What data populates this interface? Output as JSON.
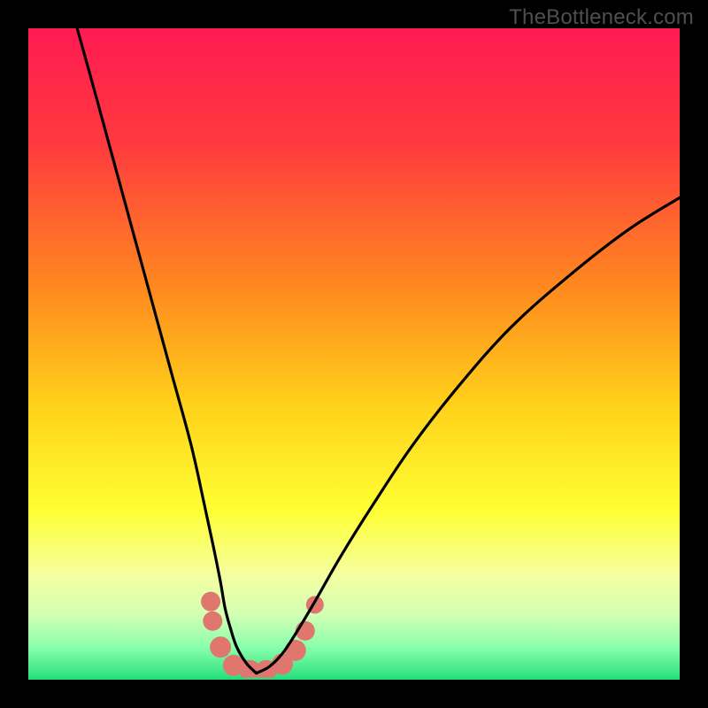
{
  "watermark": "TheBottleneck.com",
  "chart_data": {
    "type": "line",
    "title": "",
    "xlabel": "",
    "ylabel": "",
    "xlim": [
      0,
      100
    ],
    "ylim": [
      0,
      100
    ],
    "grid": false,
    "legend": false,
    "gradient_stops": [
      {
        "offset": 0.0,
        "color": "#ff1a52"
      },
      {
        "offset": 0.18,
        "color": "#ff3b3e"
      },
      {
        "offset": 0.4,
        "color": "#ff8a1f"
      },
      {
        "offset": 0.58,
        "color": "#ffd21a"
      },
      {
        "offset": 0.74,
        "color": "#ffff33"
      },
      {
        "offset": 0.84,
        "color": "#f4ffa0"
      },
      {
        "offset": 0.9,
        "color": "#d3ffb3"
      },
      {
        "offset": 0.95,
        "color": "#8affad"
      },
      {
        "offset": 1.0,
        "color": "#24e07c"
      }
    ],
    "series": [
      {
        "name": "curve-left",
        "stroke": "#000000",
        "x": [
          7.5,
          10,
          13,
          16,
          19,
          22,
          25,
          27,
          28.5,
          29.5,
          30.2,
          31,
          32,
          33.5,
          35
        ],
        "y": [
          100,
          91,
          80,
          69,
          58,
          47,
          36,
          27,
          20,
          15,
          11,
          8,
          5,
          2.5,
          1
        ]
      },
      {
        "name": "curve-right",
        "stroke": "#000000",
        "x": [
          35,
          37,
          39,
          41,
          44,
          48,
          53,
          59,
          66,
          74,
          83,
          92,
          100
        ],
        "y": [
          1,
          2,
          4,
          7,
          12,
          19,
          27,
          36,
          45,
          54,
          62,
          69,
          74
        ]
      },
      {
        "name": "floor",
        "stroke": "#24e07c",
        "x": [
          0,
          100
        ],
        "y": [
          0.2,
          0.2
        ]
      }
    ],
    "markers": [
      {
        "x": 28.0,
        "y": 12.0,
        "r": 11,
        "color": "#e0776f"
      },
      {
        "x": 28.3,
        "y": 9.0,
        "r": 11,
        "color": "#e0776f"
      },
      {
        "x": 29.5,
        "y": 5.0,
        "r": 12,
        "color": "#e0776f"
      },
      {
        "x": 31.5,
        "y": 2.2,
        "r": 12,
        "color": "#e0776f"
      },
      {
        "x": 34.0,
        "y": 1.4,
        "r": 12,
        "color": "#e0776f"
      },
      {
        "x": 36.5,
        "y": 1.4,
        "r": 12,
        "color": "#e0776f"
      },
      {
        "x": 39.0,
        "y": 2.4,
        "r": 12,
        "color": "#e0776f"
      },
      {
        "x": 41.0,
        "y": 4.5,
        "r": 12,
        "color": "#e0776f"
      },
      {
        "x": 42.5,
        "y": 7.5,
        "r": 11,
        "color": "#e0776f"
      },
      {
        "x": 44.0,
        "y": 11.5,
        "r": 10,
        "color": "#e0776f"
      }
    ]
  }
}
